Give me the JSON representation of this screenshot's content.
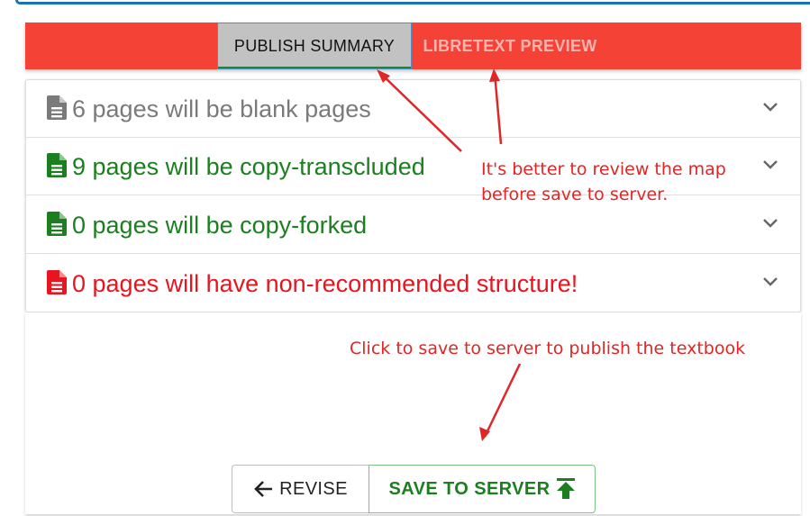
{
  "tabs": [
    {
      "label": "PUBLISH SUMMARY",
      "active": true
    },
    {
      "label": "LIBRETEXT PREVIEW",
      "active": false
    }
  ],
  "summary_rows": [
    {
      "text": "6 pages will be blank pages",
      "color": "#7a7a7a",
      "icon": "file-text-icon"
    },
    {
      "text": "9 pages will be copy-transcluded",
      "color": "#1b7f1f",
      "icon": "file-text-icon"
    },
    {
      "text": "0 pages will be copy-forked",
      "color": "#1b7f1f",
      "icon": "file-text-icon"
    },
    {
      "text": "0 pages will have non-recommended structure!",
      "color": "#e8141f",
      "icon": "file-text-icon"
    }
  ],
  "annotations": {
    "review_line1": "It's better to review the map",
    "review_line2": "before save to server.",
    "save_note": "Click to save to server to publish the textbook",
    "color": "#e02626"
  },
  "buttons": {
    "revise": "REVISE",
    "save": "SAVE TO SERVER"
  },
  "colors": {
    "tab_bar": "#f44336",
    "active_tab": "#c2c2c2",
    "success": "#1b7f1f",
    "danger": "#e8141f"
  }
}
